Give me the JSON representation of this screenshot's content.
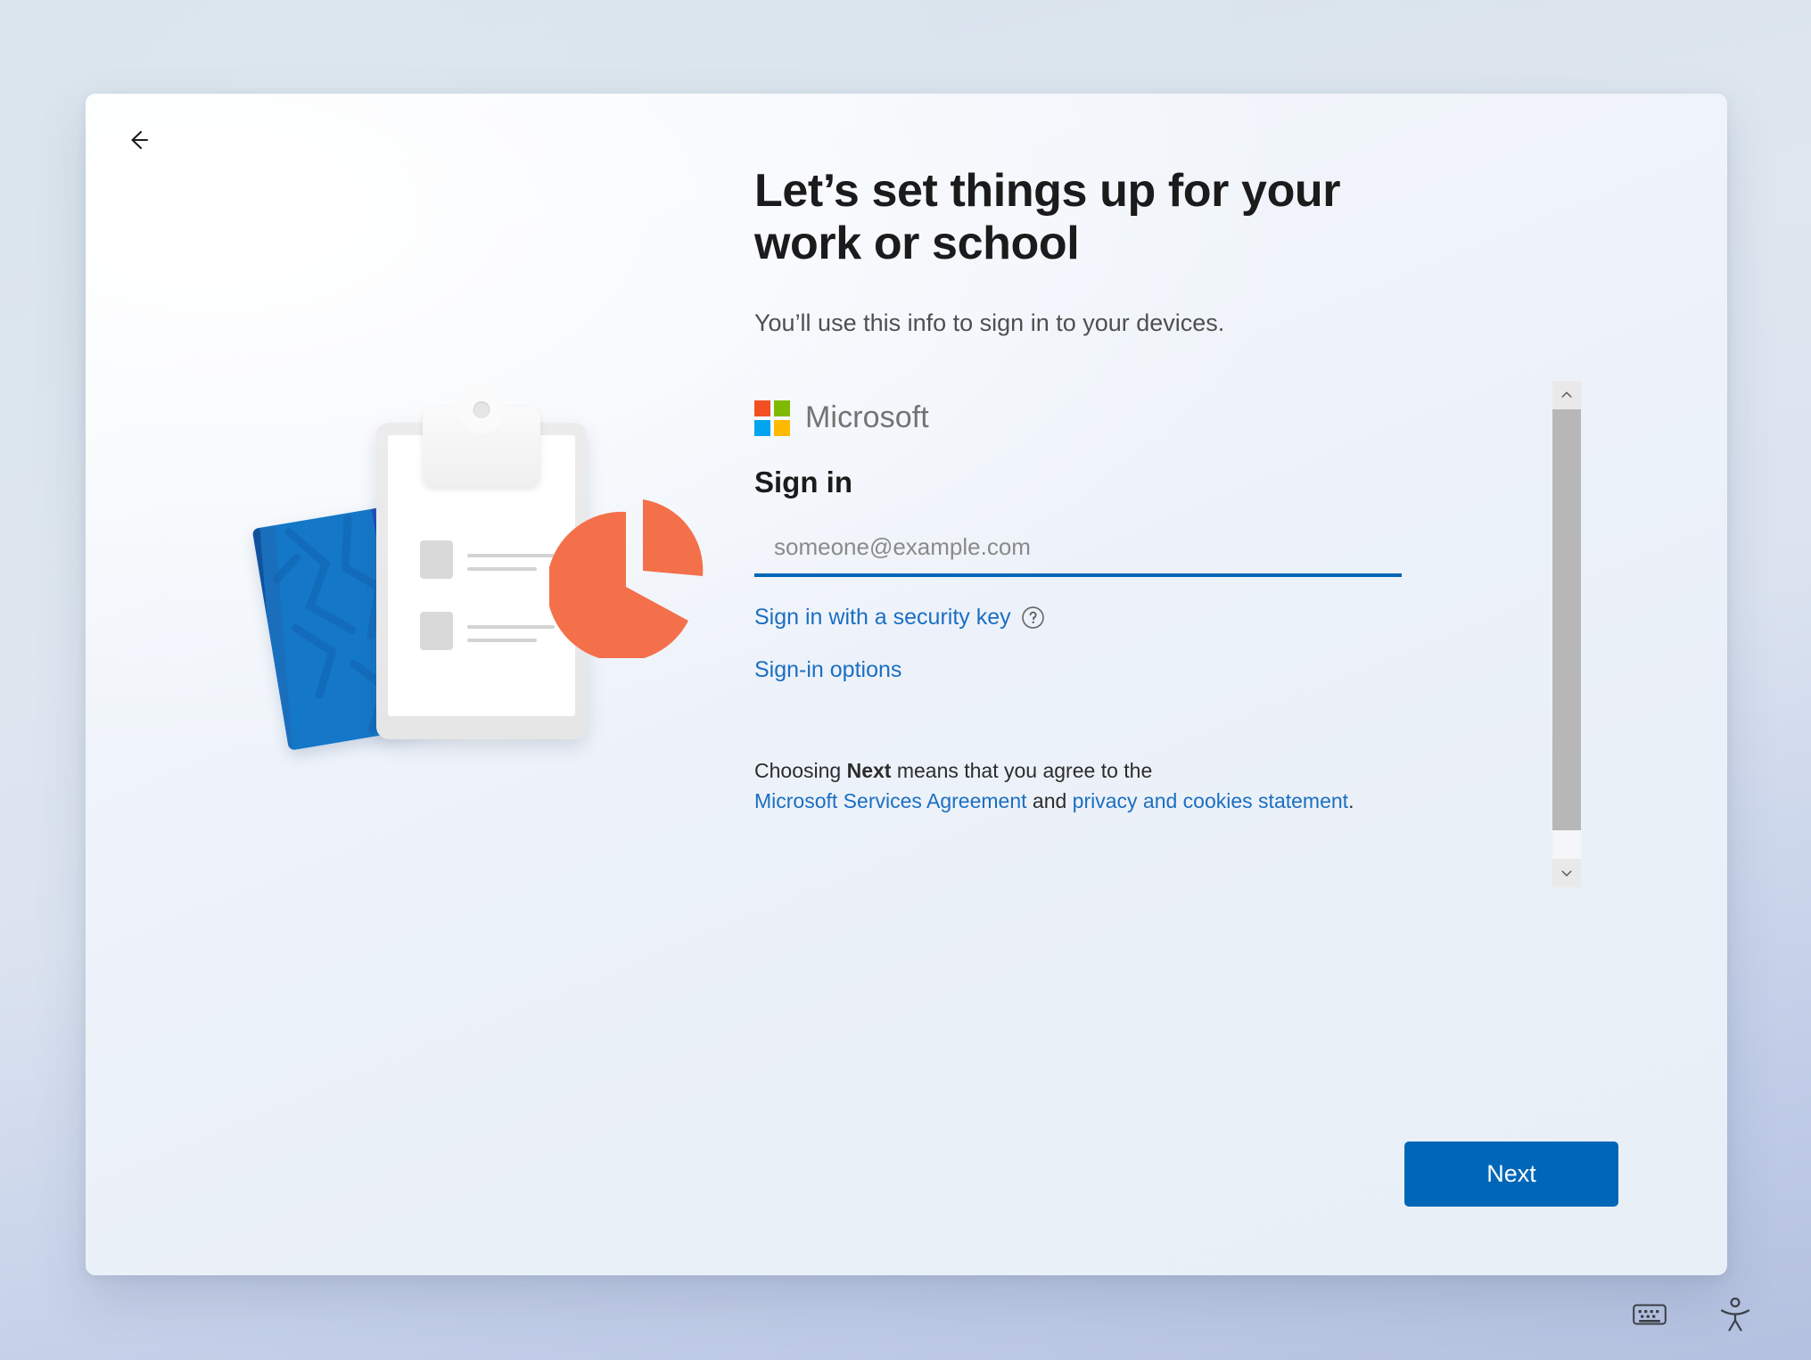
{
  "window": {
    "back_label": "Back"
  },
  "page": {
    "headline": "Let’s set things up for your work or school",
    "subhead": "You’ll use this info to sign in to your devices."
  },
  "signin": {
    "brand": "Microsoft",
    "title": "Sign in",
    "email_placeholder": "someone@example.com",
    "email_value": "",
    "security_key_link": "Sign in with a security key",
    "help_icon": "help-circle-icon",
    "options_link": "Sign-in options",
    "legal": {
      "part1": "Choosing ",
      "bold": "Next",
      "part2": " means that you agree to the ",
      "link1": "Microsoft Services Agreement",
      "part3": " and ",
      "link2": "privacy and cookies statement",
      "part4": "."
    }
  },
  "scrollbar": {
    "up_icon": "chevron-up-icon",
    "down_icon": "chevron-down-icon"
  },
  "actions": {
    "next_label": "Next"
  },
  "tray": {
    "keyboard_icon": "on-screen-keyboard-icon",
    "accessibility_icon": "accessibility-icon"
  },
  "colors": {
    "accent": "#0067b8",
    "link": "#1b6ec2",
    "ms_red": "#f25022",
    "ms_green": "#7fba00",
    "ms_blue": "#00a4ef",
    "ms_yellow": "#ffb900",
    "pie_orange": "#f4704a",
    "notebook_blue": "#1477c8",
    "card_bg": "#f2f6fb"
  }
}
